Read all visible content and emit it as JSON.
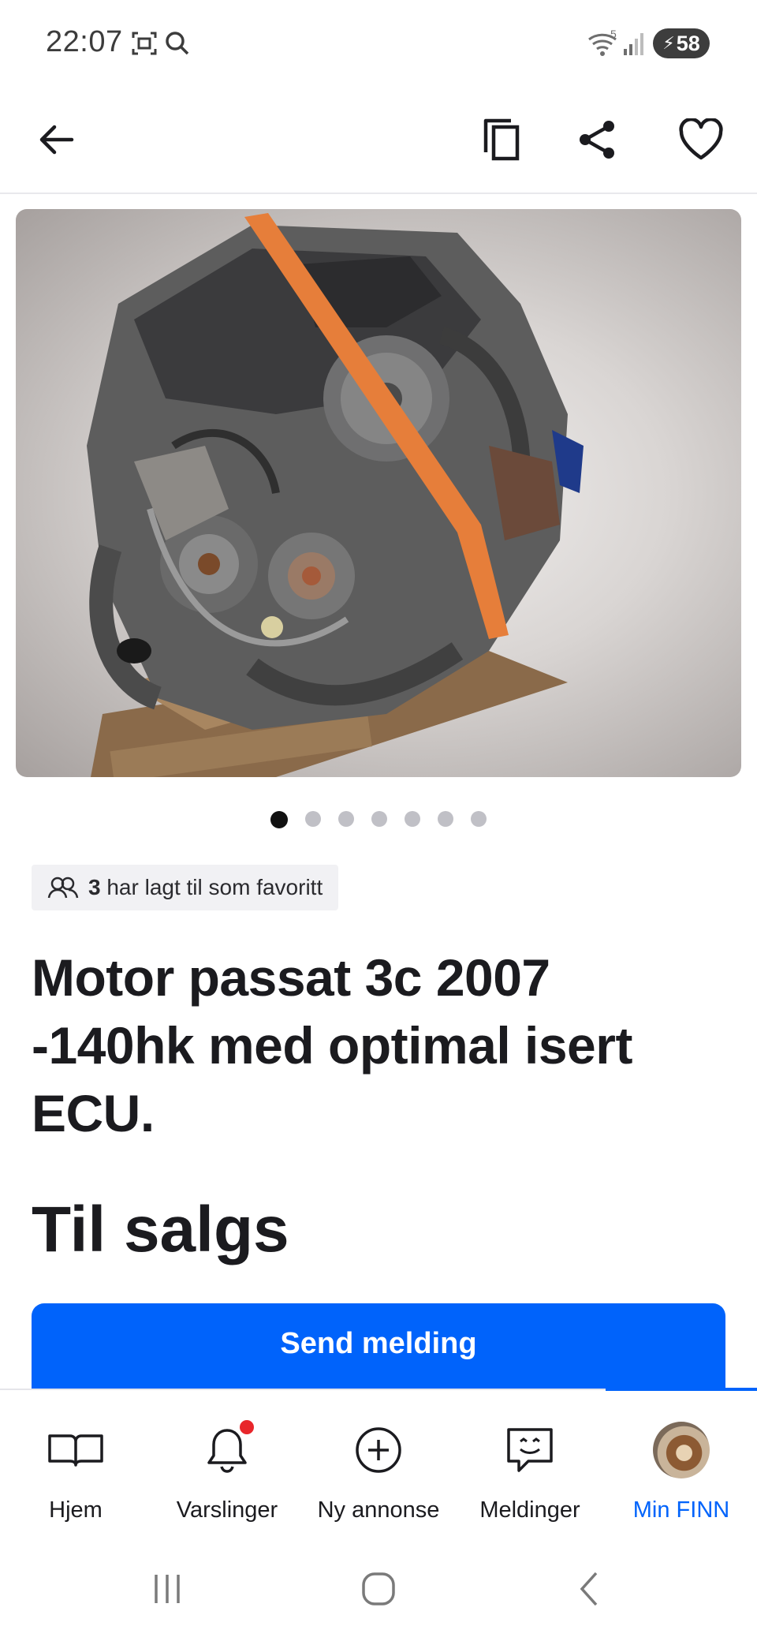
{
  "status_bar": {
    "time": "22:07",
    "battery": "58",
    "network_label": "5"
  },
  "toolbar": {
    "back_icon": "arrow-left-icon",
    "copy_icon": "copy-icon",
    "share_icon": "share-icon",
    "favorite_icon": "heart-icon"
  },
  "gallery": {
    "image_description_icon": "engine-photo",
    "total_images": 7,
    "current_index": 1
  },
  "favorites": {
    "count": "3",
    "text": "har lagt til som favoritt"
  },
  "listing": {
    "title": "Motor passat 3c 2007 -140hk med optimal isert ECU.",
    "status": "Til salgs"
  },
  "actions": {
    "send_message": "Send melding"
  },
  "bottom_nav": {
    "items": [
      {
        "label": "Hjem",
        "icon": "book-icon"
      },
      {
        "label": "Varslinger",
        "icon": "bell-icon"
      },
      {
        "label": "Ny annonse",
        "icon": "plus-circle-icon"
      },
      {
        "label": "Meldinger",
        "icon": "chat-icon"
      },
      {
        "label": "Min FINN",
        "icon": "avatar"
      }
    ],
    "active_index": 4
  },
  "colors": {
    "accent": "#0063fb",
    "notification": "#e8262b",
    "text": "#1b1b1f"
  }
}
